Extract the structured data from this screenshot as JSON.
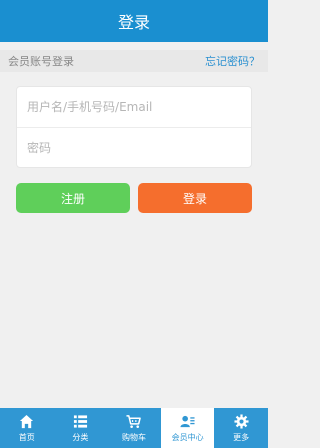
{
  "header": {
    "title": "登录"
  },
  "account": {
    "label": "会员账号登录",
    "forgot": "忘记密码？"
  },
  "form": {
    "username_placeholder": "用户名/手机号码/Email",
    "password_placeholder": "密码"
  },
  "buttons": {
    "register": "注册",
    "login": "登录"
  },
  "tabs": [
    {
      "label": "首页",
      "icon": "home-icon"
    },
    {
      "label": "分类",
      "icon": "list-icon"
    },
    {
      "label": "购物车",
      "icon": "cart-icon"
    },
    {
      "label": "会员中心",
      "icon": "user-card-icon",
      "active": true
    },
    {
      "label": "更多",
      "icon": "gear-icon"
    }
  ],
  "colors": {
    "header_bg": "#1a8fd0",
    "register_bg": "#5fcf5a",
    "login_bg": "#f56e2d",
    "tabbar_bg": "#3097d3"
  }
}
